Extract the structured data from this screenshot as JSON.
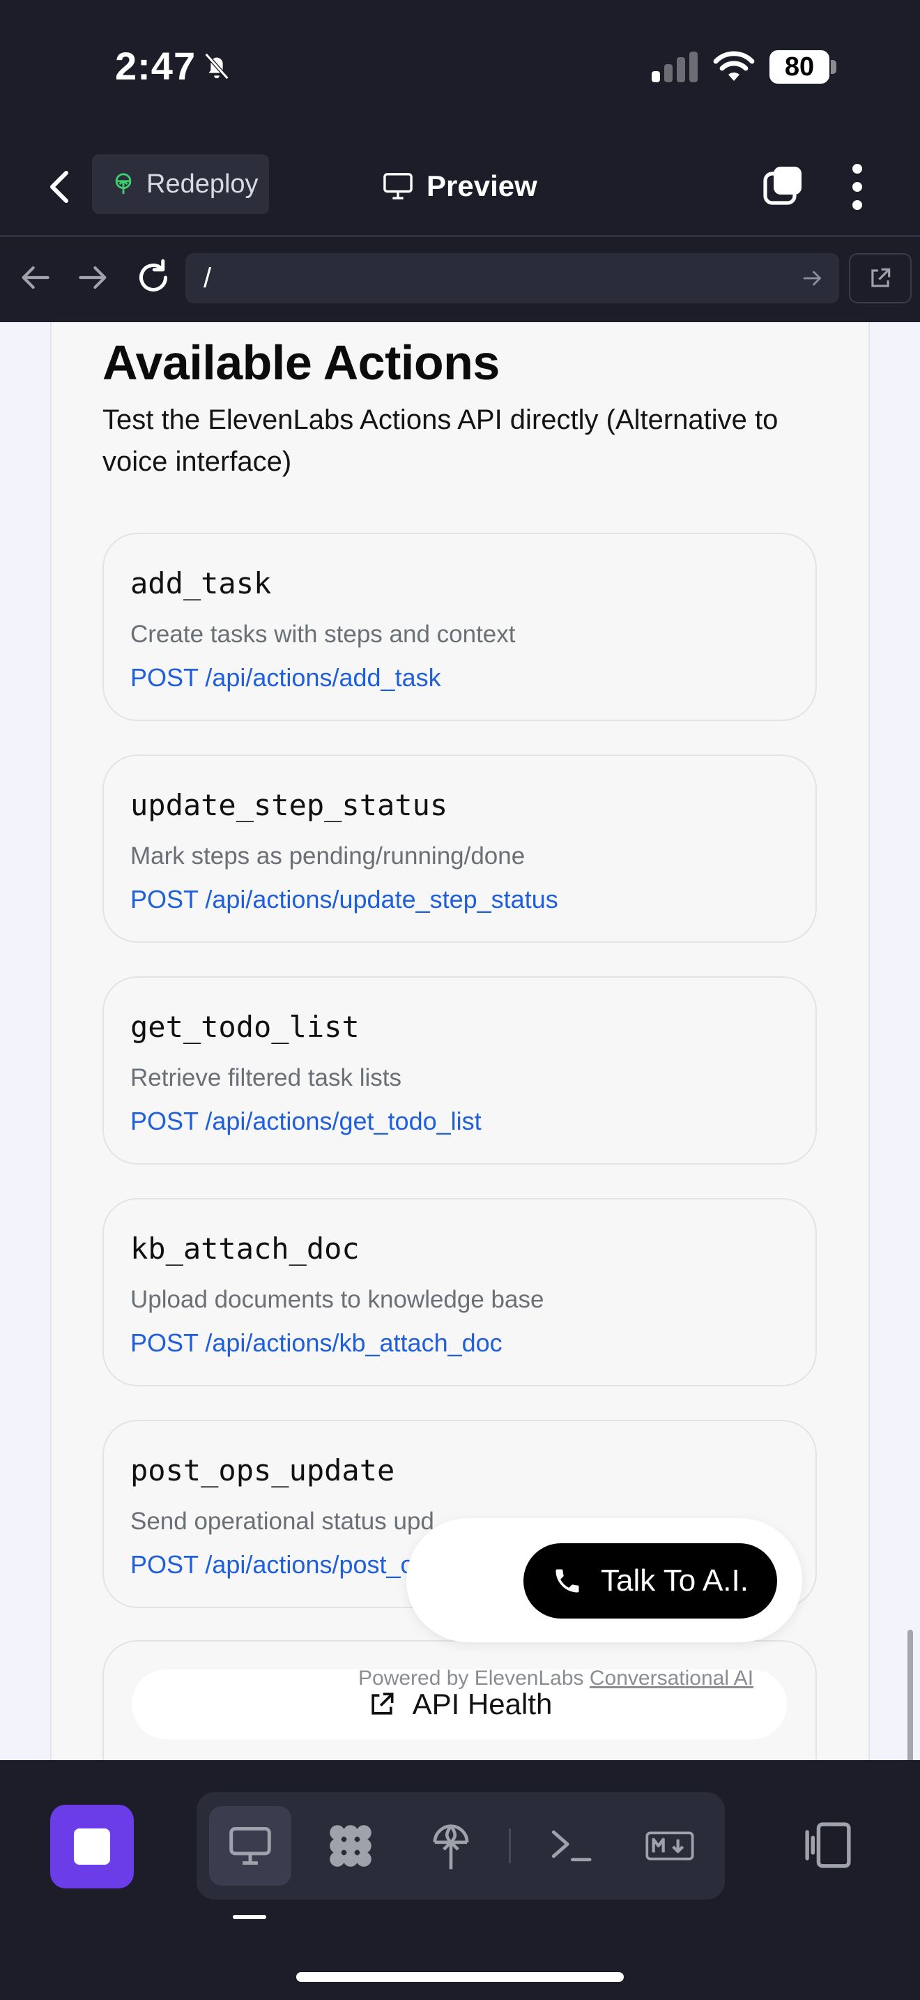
{
  "status_bar": {
    "time": "2:47",
    "battery": "80"
  },
  "header": {
    "back_icon": "chevron-left-icon",
    "redeploy_label": "Redeploy",
    "title": "Preview",
    "title_icon": "monitor-icon"
  },
  "browser": {
    "url": "/"
  },
  "content": {
    "title": "Available Actions",
    "description": "Test the ElevenLabs Actions API directly (Alternative to voice interface)",
    "actions": [
      {
        "name": "add_task",
        "description": "Create tasks with steps and context",
        "endpoint": "POST /api/actions/add_task"
      },
      {
        "name": "update_step_status",
        "description": "Mark steps as pending/running/done",
        "endpoint": "POST /api/actions/update_step_status"
      },
      {
        "name": "get_todo_list",
        "description": "Retrieve filtered task lists",
        "endpoint": "POST /api/actions/get_todo_list"
      },
      {
        "name": "kb_attach_doc",
        "description": "Upload documents to knowledge base",
        "endpoint": "POST /api/actions/kb_attach_doc"
      },
      {
        "name": "post_ops_update",
        "description": "Send operational status upd",
        "endpoint": "POST /api/actions/post_o"
      }
    ],
    "health_button": "API Health"
  },
  "widget": {
    "talk_label": "Talk To A.I.",
    "powered_by": "Powered by ElevenLabs",
    "powered_link": "Conversational AI"
  },
  "colors": {
    "accent_purple": "#6a3de8",
    "link_blue": "#1f5fdc",
    "chrome_dark": "#1c1d29"
  }
}
